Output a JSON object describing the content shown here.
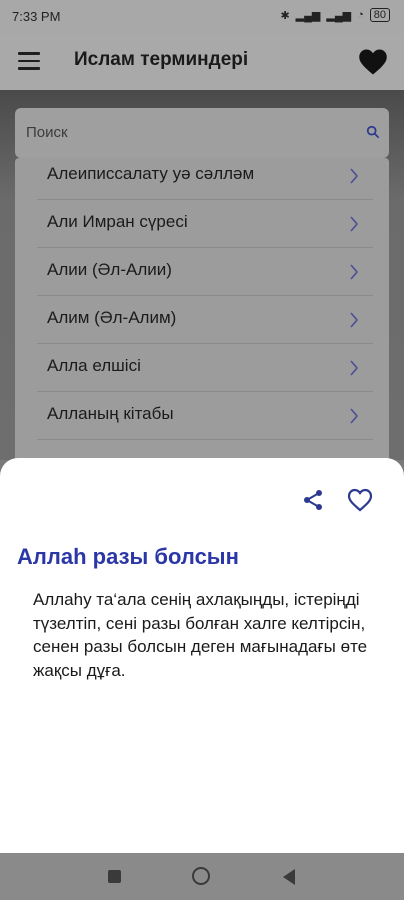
{
  "status_bar": {
    "time": "7:33 PM",
    "battery": "80"
  },
  "app_bar": {
    "title": "Ислам терминдері"
  },
  "search": {
    "placeholder": "Поиск"
  },
  "list": {
    "items": [
      {
        "label": "Алеиписсалату уә сәлләм"
      },
      {
        "label": "Али Имран сүресі"
      },
      {
        "label": "Алии (Әл-Алии)"
      },
      {
        "label": "Алим (Әл-Алим)"
      },
      {
        "label": "Алла елшісі"
      },
      {
        "label": "Алланың кітабы"
      }
    ]
  },
  "sheet": {
    "title": "Аллаһ разы болсын",
    "body": "Аллаһу та‘ала сенің ахлақыңды, істеріңді түзелтіп, сені разы болған халге келтірсін, сенен разы болсын деген мағынадағы өте жақсы дұға."
  },
  "colors": {
    "accent": "#2b37a6",
    "icon_blue": "#2b3a8f"
  }
}
